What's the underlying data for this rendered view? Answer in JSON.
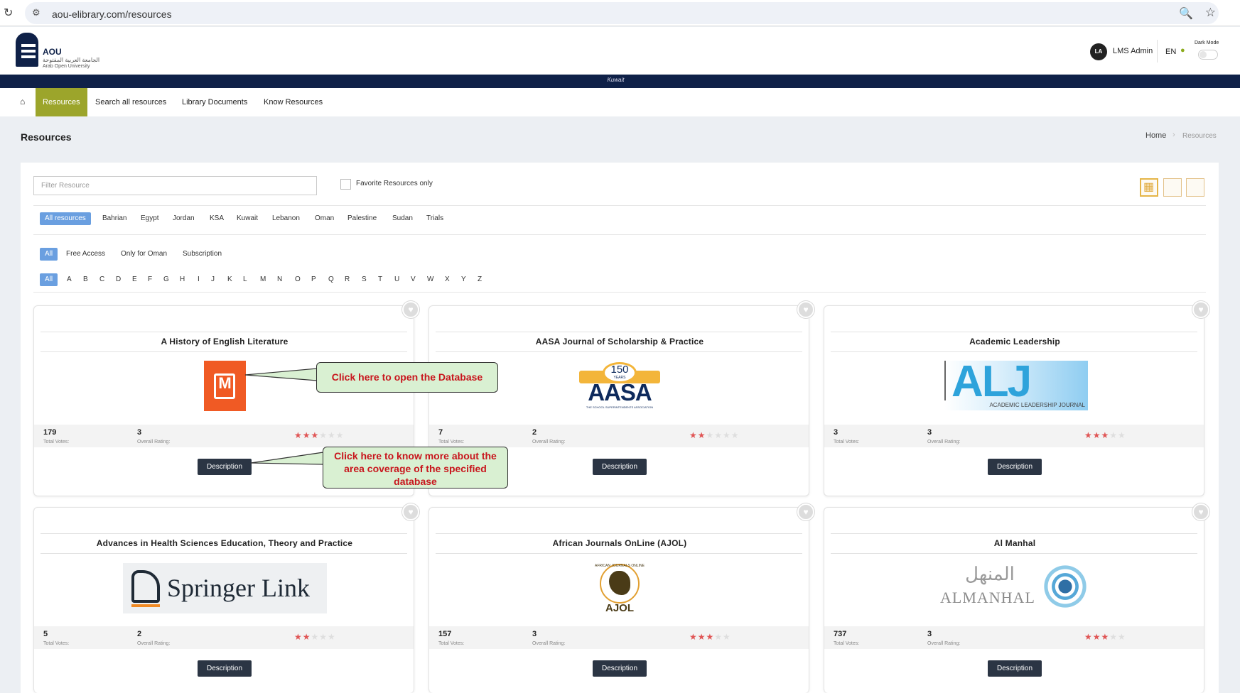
{
  "browser": {
    "url": "aou-elibrary.com/resources",
    "icons": [
      "reload-icon",
      "site-settings-icon",
      "zoom-icon",
      "bookmark-star-icon"
    ]
  },
  "header": {
    "logo_title": "AOU",
    "logo_subtitle_ar": "الجامعة العربية المفتوحة",
    "logo_subtitle_en": "Arab Open University",
    "avatar_initials": "LA",
    "user_name": "LMS Admin",
    "language": "EN",
    "dark_mode_label": "Dark Mode",
    "dark_mode_on": false,
    "region": "Kuwait",
    "brand_color": "#0f2148"
  },
  "nav": {
    "home_icon": "home-icon",
    "items": [
      "Resources",
      "Search all resources",
      "Library Documents",
      "Know Resources"
    ],
    "active": "Resources",
    "active_color": "#9ca52b"
  },
  "page": {
    "title": "Resources",
    "breadcrumb": [
      "Home",
      "Resources"
    ]
  },
  "filters": {
    "search_placeholder": "Filter Resource",
    "favorite_label": "Favorite Resources only",
    "favorite_checked": false,
    "countries": [
      "All resources",
      "Bahrian",
      "Egypt",
      "Jordan",
      "KSA",
      "Kuwait",
      "Lebanon",
      "Oman",
      "Palestine",
      "Sudan",
      "Trials"
    ],
    "country_active": "All resources",
    "access": [
      "All",
      "Free Access",
      "Only for Oman",
      "Subscription"
    ],
    "access_active": "All",
    "letters": [
      "All",
      "A",
      "B",
      "C",
      "D",
      "E",
      "F",
      "G",
      "H",
      "I",
      "J",
      "K",
      "L",
      "M",
      "N",
      "O",
      "P",
      "Q",
      "R",
      "S",
      "T",
      "U",
      "V",
      "W",
      "X",
      "Y",
      "Z"
    ],
    "letter_active": "All",
    "view_modes": [
      "grid-view-icon",
      "list-view-icon",
      "compact-view-icon"
    ],
    "view_active": "grid-view-icon"
  },
  "resources": [
    {
      "title": "A History of English Literature",
      "logo": "M",
      "votes": "179",
      "votes_label": "Total Votes:",
      "rating": "3",
      "rating_label": "Overall Rating:",
      "stars": 3,
      "button": "Description"
    },
    {
      "title": "AASA Journal of Scholarship & Practice",
      "logo": "AASA",
      "logo_badge": "150",
      "logo_badge_sub": "YEARS",
      "logo_caption": "THE SCHOOL SUPERINTENDENTS ASSOCIATION",
      "votes": "7",
      "votes_label": "Total Votes:",
      "rating": "2",
      "rating_label": "Overall Rating:",
      "stars": 2,
      "button": "Description"
    },
    {
      "title": "Academic Leadership",
      "logo": "ALJ",
      "logo_caption": "ACADEMIC LEADERSHIP JOURNAL",
      "votes": "3",
      "votes_label": "Total Votes:",
      "rating": "3",
      "rating_label": "Overall Rating:",
      "stars": 3,
      "button": "Description"
    },
    {
      "title": "Advances in Health Sciences Education, Theory and Practice",
      "logo": "Springer Link",
      "votes": "5",
      "votes_label": "Total Votes:",
      "rating": "2",
      "rating_label": "Overall Rating:",
      "stars": 2,
      "button": "Description"
    },
    {
      "title": "African Journals OnLine (AJOL)",
      "logo": "AJOL",
      "logo_ring": "AFRICAN JOURNALS ONLINE",
      "votes": "157",
      "votes_label": "Total Votes:",
      "rating": "3",
      "rating_label": "Overall Rating:",
      "stars": 3,
      "button": "Description"
    },
    {
      "title": "Al Manhal",
      "logo": "ALMANHAL",
      "logo_ar": "المنهل",
      "votes": "737",
      "votes_label": "Total Votes:",
      "rating": "3",
      "rating_label": "Overall Rating:",
      "stars": 3,
      "button": "Description"
    }
  ],
  "annotations": {
    "open_database": "Click here to open the Database",
    "description_help": "Click here to know more about the area coverage of the specified database",
    "callout_bg": "#d9f0d2",
    "callout_text_color": "#c8161d"
  }
}
